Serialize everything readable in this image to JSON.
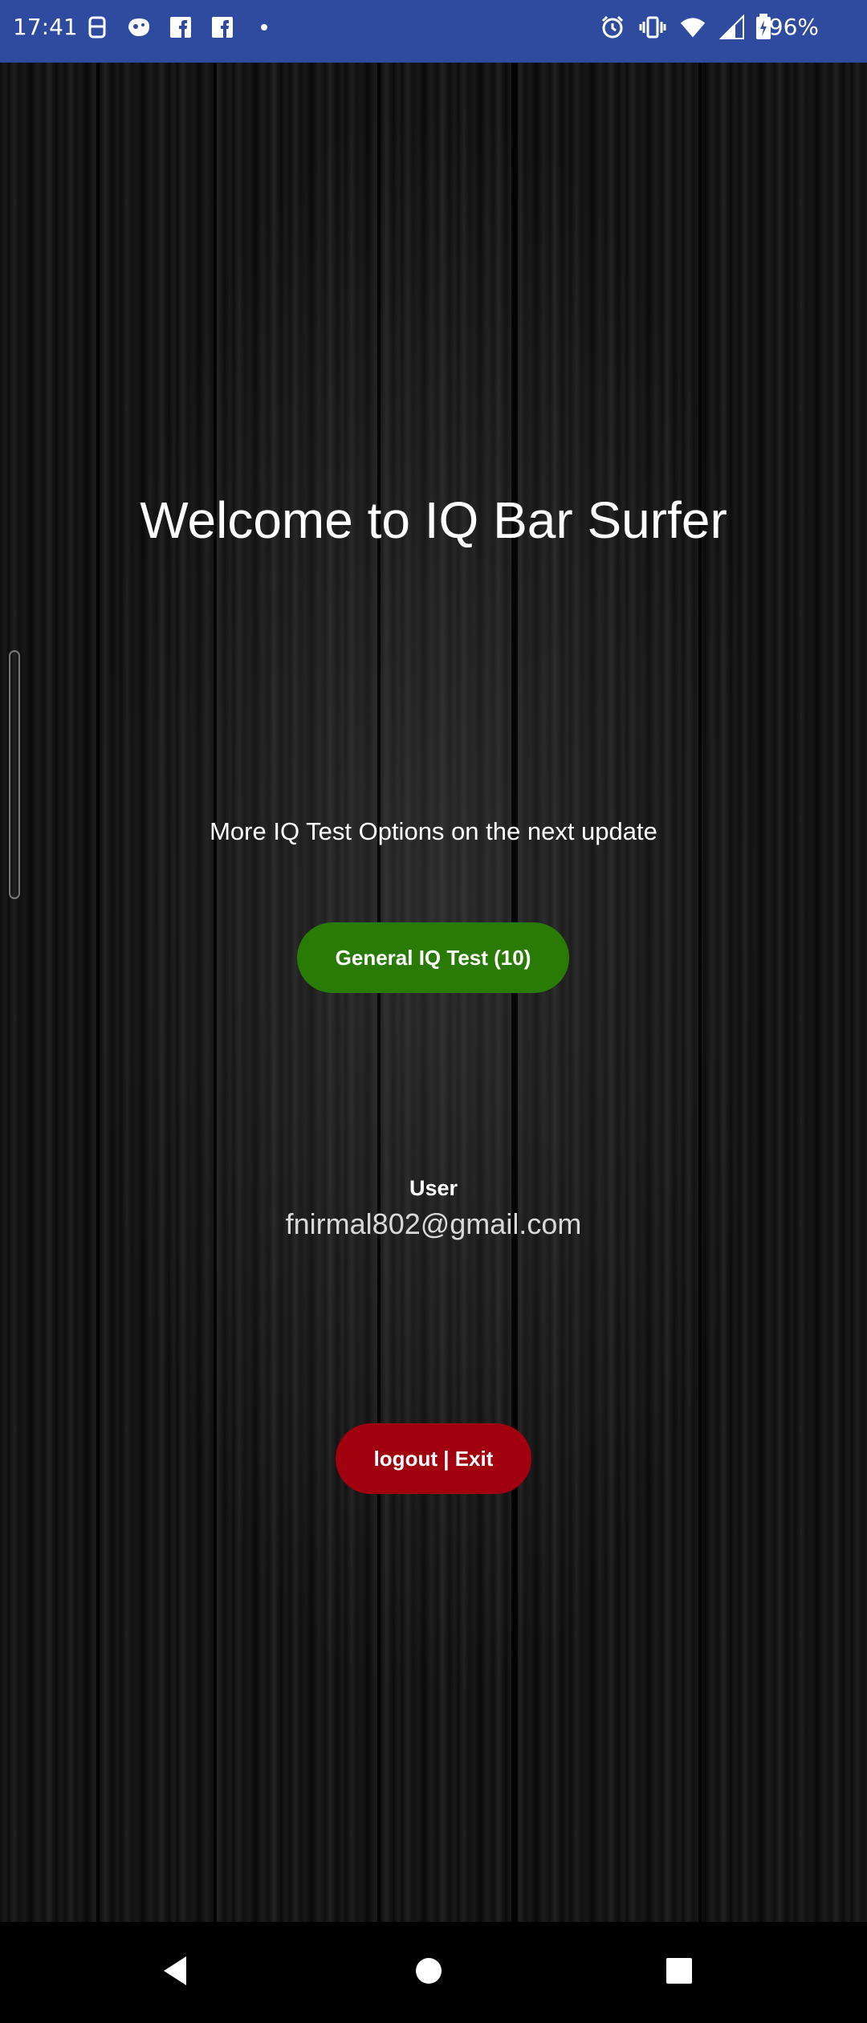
{
  "status_bar": {
    "time": "17:41",
    "battery": "96%",
    "left_icons": [
      "sim-toolkit-icon",
      "game-icon",
      "facebook-icon",
      "facebook-icon",
      "dot-icon"
    ],
    "right_icons": [
      "alarm-icon",
      "vibrate-icon",
      "wifi-icon",
      "signal-icon"
    ],
    "background_color": "#2f4ba0"
  },
  "main": {
    "title": "Welcome to IQ Bar Surfer",
    "update_note": "More IQ Test Options on the next update",
    "general_test_button": "General IQ Test (10)",
    "user_label": "User",
    "user_email": "fnirmal802@gmail.com",
    "logout_button": "logout | Exit"
  },
  "colors": {
    "general_button": "#2a7a06",
    "logout_button": "#a1000e"
  },
  "nav_bar": {
    "buttons": [
      "back-icon",
      "home-icon",
      "recents-icon"
    ]
  }
}
